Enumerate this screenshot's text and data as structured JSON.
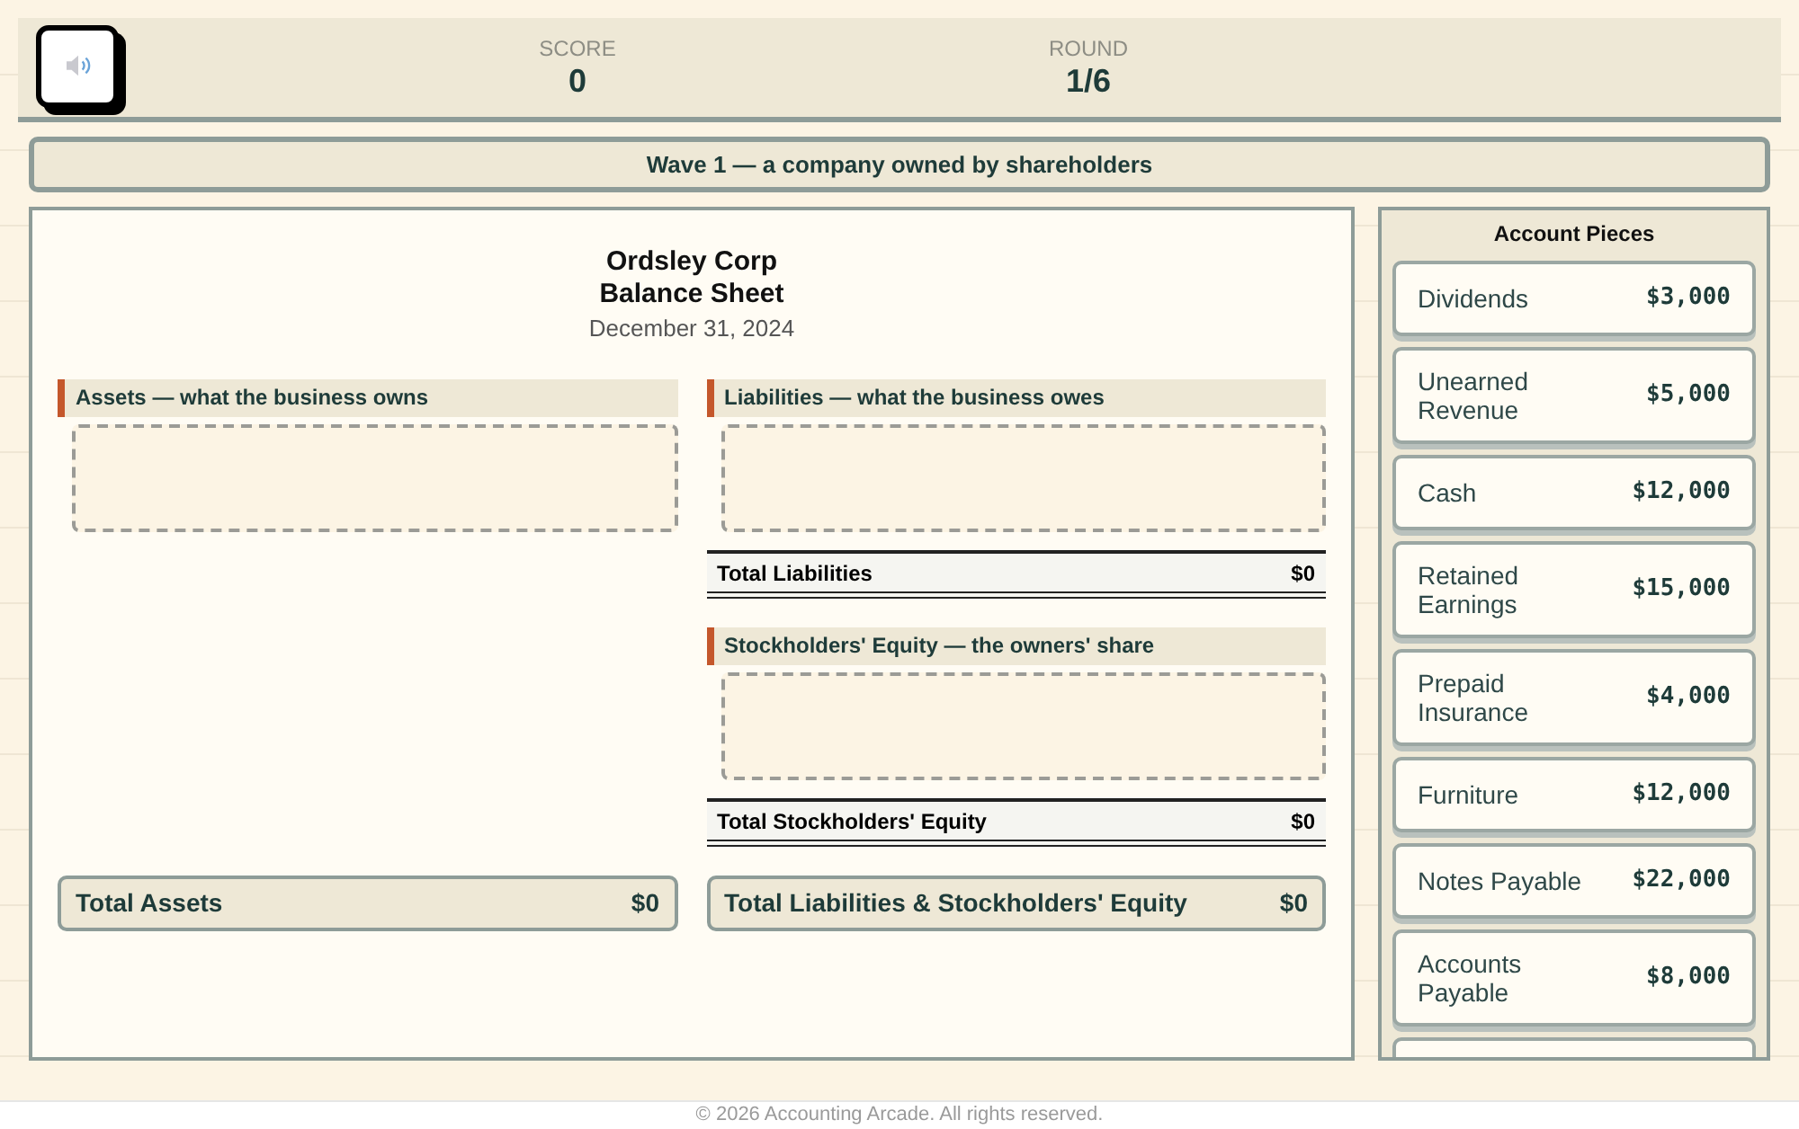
{
  "header": {
    "stats": [
      {
        "label": "SCORE",
        "value": "0"
      },
      {
        "label": "ROUND",
        "value": "1/6"
      }
    ]
  },
  "banner": "Wave 1 — a company owned by shareholders",
  "sheet": {
    "company": "Ordsley Corp",
    "title": "Balance Sheet",
    "date": "December 31, 2024",
    "columns": [
      {
        "sections": [
          {
            "heading": "Assets — what the business owns"
          }
        ],
        "grand_total": {
          "label": "Total Assets",
          "value": "$0"
        }
      },
      {
        "sections": [
          {
            "heading": "Liabilities — what the business owes",
            "total": {
              "label": "Total Liabilities",
              "value": "$0"
            }
          },
          {
            "heading": "Stockholders' Equity — the owners' share",
            "total": {
              "label": "Total Stockholders' Equity",
              "value": "$0"
            }
          }
        ],
        "grand_total": {
          "label": "Total Liabilities & Stockholders' Equity",
          "value": "$0"
        }
      }
    ]
  },
  "pieces": {
    "title": "Account Pieces",
    "more_below": true,
    "items": [
      {
        "name": "Dividends",
        "amount": "$3,000"
      },
      {
        "name": "Unearned Revenue",
        "amount": "$5,000"
      },
      {
        "name": "Cash",
        "amount": "$12,000"
      },
      {
        "name": "Retained Earnings",
        "amount": "$15,000"
      },
      {
        "name": "Prepaid Insurance",
        "amount": "$4,000"
      },
      {
        "name": "Furniture",
        "amount": "$12,000"
      },
      {
        "name": "Notes Payable",
        "amount": "$22,000"
      },
      {
        "name": "Accounts Payable",
        "amount": "$8,000"
      }
    ]
  },
  "footer": "© 2026 Accounting Arcade. All rights reserved."
}
